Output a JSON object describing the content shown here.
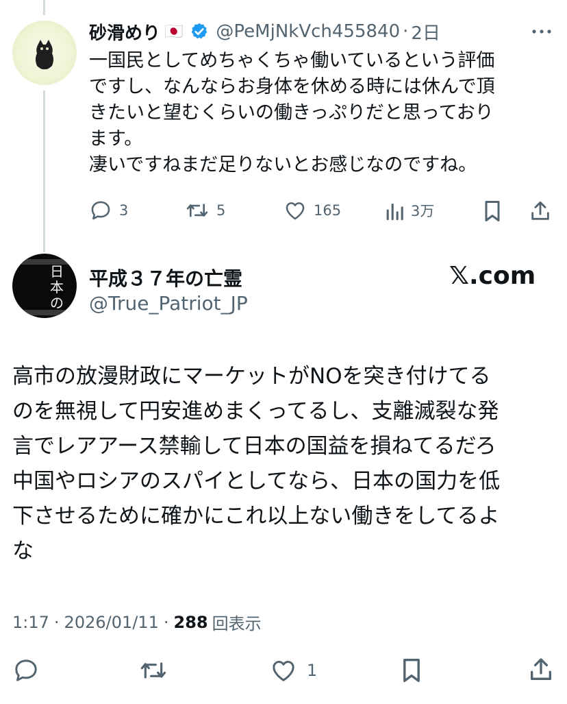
{
  "reply": {
    "display_name": "砂滑めり",
    "flag": "🇯🇵",
    "handle": "@PeMjNkVch455840",
    "separator": "·",
    "time": "2日",
    "body": "一国民としてめちゃくちゃ働いているという評価\nですし、なんならお身体を休める時には休んで頂\nきたいと望むくらいの働きっぷりだと思っており\nます。\n凄いですねまだ足りないとお感じなのですね。",
    "actions": {
      "replies": "3",
      "reposts": "5",
      "likes": "165",
      "views": "3万"
    }
  },
  "main": {
    "display_name": "平成３７年の亡霊",
    "handle": "@True_Patriot_JP",
    "watermark": "𝕏.com",
    "avatar_text": [
      "日",
      "本",
      "の"
    ],
    "body": "高市の放漫財政にマーケットがNOを突き付けてる\nのを無視して円安進めまくってるし、支離滅裂な発\n言でレアアース禁輸して日本の国益を損ねてるだろ\n中国やロシアのスパイとしてなら、日本の国力を低\n下させるために確かにこれ以上ない働きをしてるよ\nな",
    "meta": {
      "time": "1:17",
      "dot1": "·",
      "date": "2026/01/11",
      "dot2": "·",
      "views_count": "288",
      "views_label": "回表示"
    },
    "actions": {
      "likes": "1"
    }
  },
  "colors": {
    "verified": "#1d9bf0",
    "text": "#0f1419",
    "secondary": "#536471",
    "thread_line": "#cfd9de"
  }
}
